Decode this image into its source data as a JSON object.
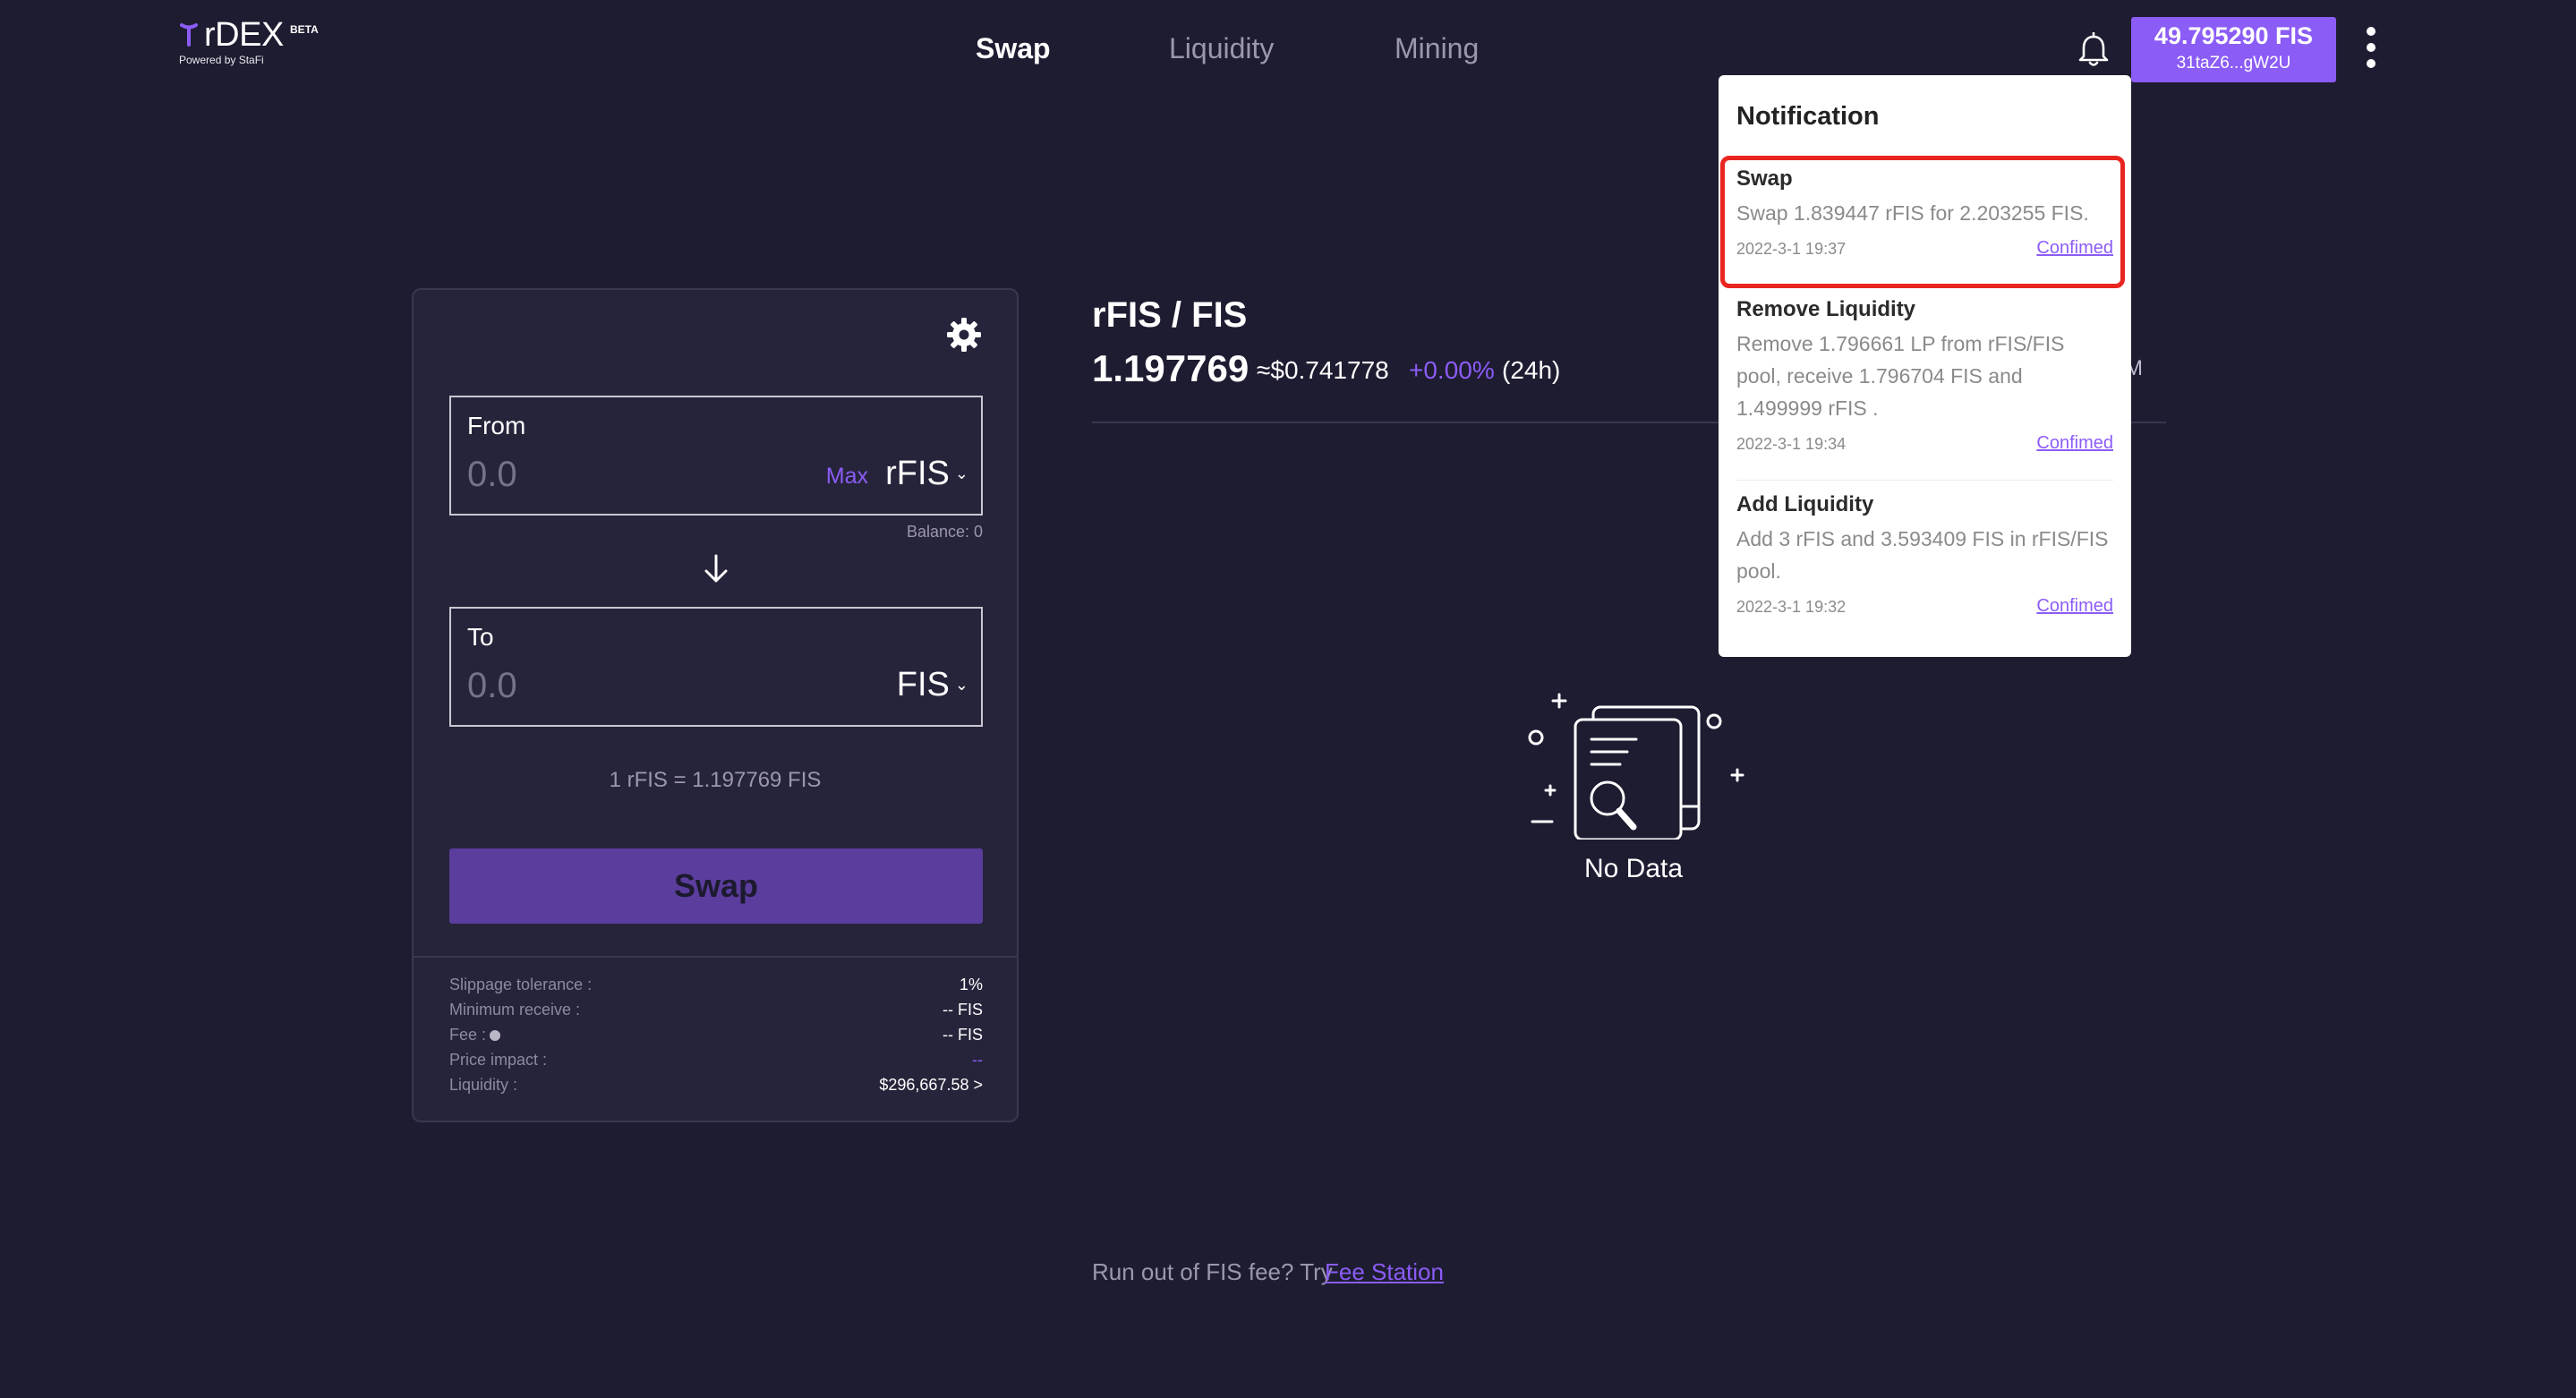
{
  "header": {
    "logo": {
      "name": "rDEX",
      "badge": "BETA",
      "powered_by": "Powered by StaFi"
    },
    "nav": [
      {
        "label": "Swap",
        "active": true
      },
      {
        "label": "Liquidity"
      },
      {
        "label": "Mining"
      }
    ],
    "wallet": {
      "balance": "49.795290 FIS",
      "address": "31taZ6...gW2U"
    },
    "icons": {
      "bell": "bell-icon",
      "more": "more-vertical-icon"
    }
  },
  "swap_panel": {
    "from": {
      "label": "From",
      "value": "0.0",
      "max": "Max",
      "token": "rFIS"
    },
    "balance": "Balance: 0",
    "to": {
      "label": "To",
      "value": "0.0",
      "token": "FIS"
    },
    "rate": "1 rFIS = 1.197769 FIS",
    "swap_button": "Swap",
    "details": [
      {
        "label": "Slippage tolerance :",
        "value": "1%"
      },
      {
        "label": "Minimum receive :",
        "value": "-- FIS"
      },
      {
        "label": "Fee :",
        "value": "-- FIS"
      },
      {
        "label": "Price impact :",
        "value": "--"
      },
      {
        "label": "Liquidity :",
        "value": "$296,667.58 >"
      }
    ]
  },
  "market": {
    "pair": "rFIS / FIS",
    "price": "1.197769",
    "usd": "≈$0.741778",
    "change": "+0.00%",
    "period": "(24h)",
    "tail": "M",
    "no_data": "No Data"
  },
  "footer": {
    "text": "Run out of FIS fee? Try",
    "link": "Fee Station"
  },
  "notification": {
    "title": "Notification",
    "items": [
      {
        "title": "Swap",
        "body": "Swap 1.839447 rFIS for 2.203255 FIS.",
        "time": "2022-3-1 19:37",
        "status": "Confimed"
      },
      {
        "title": "Remove Liquidity",
        "body": "Remove 1.796661 LP from rFIS/FIS pool, receive 1.796704 FIS and 1.499999 rFIS .",
        "time": "2022-3-1 19:34",
        "status": "Confimed"
      },
      {
        "title": "Add Liquidity",
        "body": "Add 3 rFIS and 3.593409 FIS in rFIS/FIS pool.",
        "time": "2022-3-1 19:32",
        "status": "Confimed"
      }
    ]
  },
  "colors": {
    "background": "#1e1c31",
    "panel": "#26243a",
    "accent": "#8b5cf6",
    "swap_button": "#5b3d9e",
    "highlight": "#e8261f"
  }
}
